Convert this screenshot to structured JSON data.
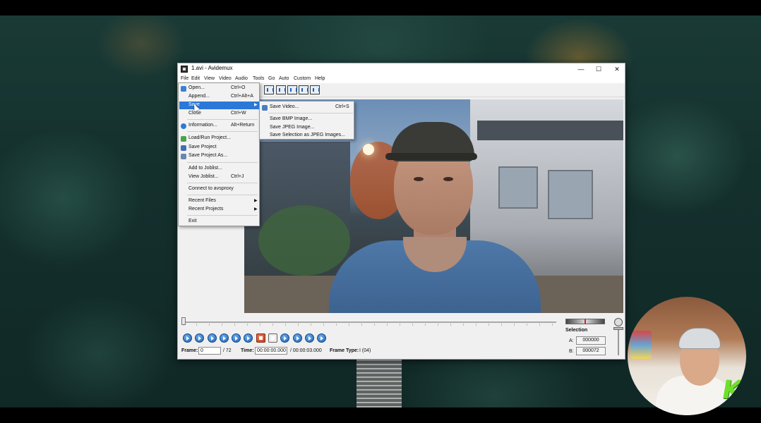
{
  "window": {
    "title": "1.avi - Avidemux",
    "minimize": "—",
    "maximize": "☐",
    "close": "✕"
  },
  "menubar": [
    "File",
    "Edit",
    "View",
    "Video",
    "Audio",
    "Tools",
    "Go",
    "Auto",
    "Custom",
    "Help"
  ],
  "file_menu": {
    "items": [
      {
        "label": "Open...",
        "shortcut": "Ctrl+O",
        "icon": "open-icon"
      },
      {
        "label": "Append...",
        "shortcut": "Ctrl+Alt+A",
        "icon": ""
      },
      {
        "label": "Save",
        "shortcut": "",
        "icon": "",
        "submenu": true
      },
      {
        "label": "Close",
        "shortcut": "Ctrl+W",
        "icon": ""
      },
      {
        "label": "Information...",
        "shortcut": "Alt+Return",
        "icon": "info-icon"
      },
      {
        "label": "Load/Run Project...",
        "shortcut": "",
        "icon": "project-icon"
      },
      {
        "label": "Save Project",
        "shortcut": "",
        "icon": "save-project-icon"
      },
      {
        "label": "Save Project As...",
        "shortcut": "",
        "icon": "save-project-as-icon"
      },
      {
        "label": "Add to Joblist...",
        "shortcut": "",
        "icon": ""
      },
      {
        "label": "View Joblist...",
        "shortcut": "Ctrl+J",
        "icon": ""
      },
      {
        "label": "Connect to avsproxy",
        "shortcut": "",
        "icon": ""
      },
      {
        "label": "Recent Files",
        "shortcut": "",
        "icon": "",
        "submenu": true
      },
      {
        "label": "Recent Projects",
        "shortcut": "",
        "icon": "",
        "submenu": true
      },
      {
        "label": "Exit",
        "shortcut": "",
        "icon": ""
      }
    ]
  },
  "save_submenu": {
    "items": [
      {
        "label": "Save Video...",
        "shortcut": "Ctrl+S",
        "icon": "save-video-icon"
      },
      {
        "label": "Save BMP Image...",
        "shortcut": ""
      },
      {
        "label": "Save JPEG Image...",
        "shortcut": ""
      },
      {
        "label": "Save Selection as JPEG Images...",
        "shortcut": ""
      }
    ]
  },
  "selection": {
    "title": "Selection",
    "a_label": "A:",
    "a_value": "000000",
    "b_label": "B:",
    "b_value": "000072"
  },
  "status": {
    "frame_label": "Frame:",
    "frame_value": "0",
    "frame_total": "/ 72",
    "time_label": "Time:",
    "time_value": "00:00:00.000",
    "time_total": "/ 00:00:03.000",
    "frame_type_label": "Frame Type:",
    "frame_type_value": "I (04)"
  },
  "colors": {
    "highlight": "#2b78d8",
    "control_blue": "#1d5fb0"
  }
}
